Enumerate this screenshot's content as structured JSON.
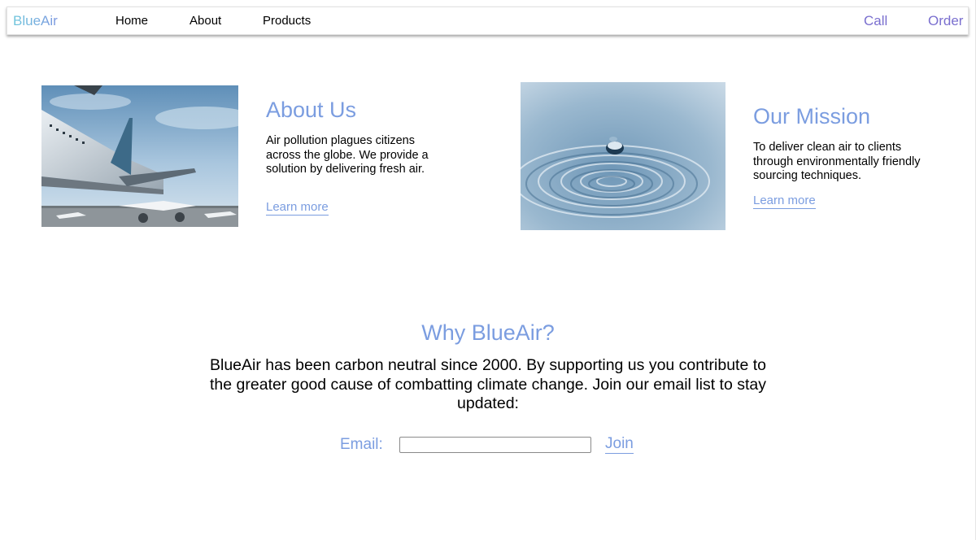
{
  "nav": {
    "brand": "BlueAir",
    "links": [
      "Home",
      "About",
      "Products"
    ],
    "call": "Call",
    "order": "Order"
  },
  "about": {
    "title": "About Us",
    "text": "Air pollution plagues citizens across the globe. We provide a solution by delivering fresh air.",
    "link": "Learn more"
  },
  "mission": {
    "title": "Our Mission",
    "text": "To deliver clean air to clients through environmentally friendly sourcing techniques.",
    "link": "Learn more"
  },
  "why": {
    "title": "Why BlueAir?",
    "text": "BlueAir has been carbon neutral since 2000. By supporting us you contribute to the greater good cause of combatting climate change. Join our email list to stay updated:"
  },
  "signup": {
    "label": "Email:",
    "value": "",
    "button": "Join"
  },
  "colors": {
    "accent": "#7b9de0",
    "nav_right": "#7a6fcf"
  },
  "images": {
    "about": "airplane-image",
    "mission": "water-drop-image"
  }
}
